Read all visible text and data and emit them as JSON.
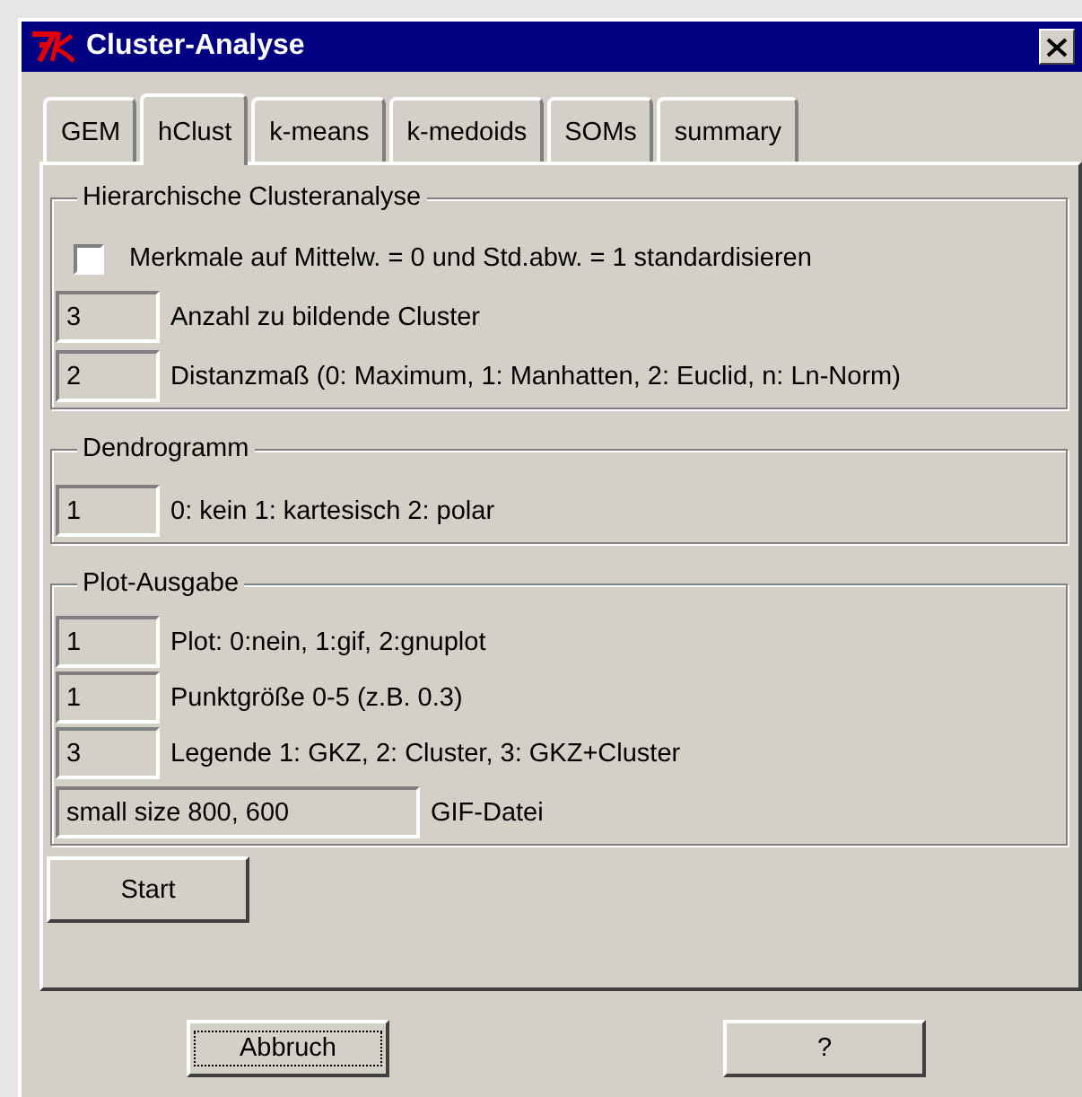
{
  "window": {
    "title": "Cluster-Analyse"
  },
  "tabs": [
    {
      "label": "GEM",
      "selected": false
    },
    {
      "label": "hClust",
      "selected": true
    },
    {
      "label": "k-means",
      "selected": false
    },
    {
      "label": "k-medoids",
      "selected": false
    },
    {
      "label": "SOMs",
      "selected": false
    },
    {
      "label": "summary",
      "selected": false
    }
  ],
  "groups": [
    {
      "title": "Hierarchische Clusteranalyse",
      "rows": [
        {
          "kind": "checkbox",
          "label": "Merkmale auf Mittelw. = 0 und Std.abw. = 1 standardisieren",
          "checked": false
        },
        {
          "kind": "field",
          "value": "3",
          "label": "Anzahl zu bildende Cluster"
        },
        {
          "kind": "field",
          "value": "2",
          "label": "Distanzmaß (0: Maximum, 1: Manhatten, 2: Euclid, n: Ln-Norm)"
        }
      ]
    },
    {
      "title": "Dendrogramm",
      "rows": [
        {
          "kind": "field",
          "value": "1",
          "label": "0: kein 1: kartesisch 2: polar"
        }
      ]
    },
    {
      "title": "Plot-Ausgabe",
      "rows": [
        {
          "kind": "field",
          "value": "1",
          "label": "Plot: 0:nein, 1:gif, 2:gnuplot"
        },
        {
          "kind": "field",
          "value": "1",
          "label": "Punktgröße 0-5 (z.B. 0.3)"
        },
        {
          "kind": "field",
          "value": "3",
          "label": "Legende 1: GKZ, 2: Cluster, 3: GKZ+Cluster"
        }
      ],
      "file_field": {
        "value": "small size 800, 600",
        "caption": "GIF-Datei"
      }
    }
  ],
  "start_button": {
    "label": "Start"
  },
  "footer_buttons": [
    {
      "label": "Abbruch",
      "focused": true
    },
    {
      "label": "?",
      "focused": false
    }
  ]
}
